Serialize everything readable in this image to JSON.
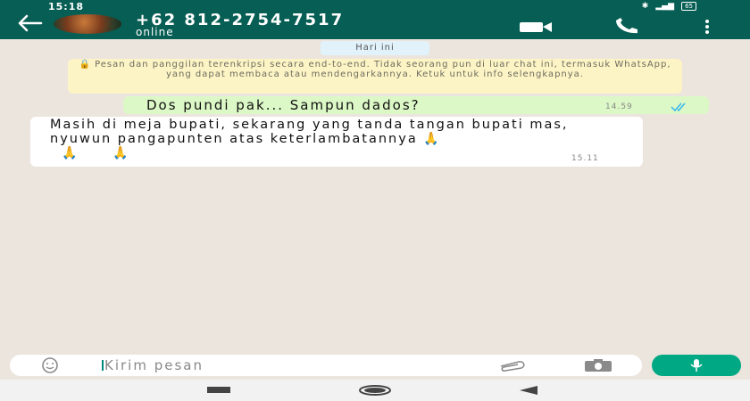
{
  "status_bar": {
    "time": "15:18",
    "battery": "65"
  },
  "header": {
    "contact_name": "+62 812-2754-7517",
    "contact_status": "online"
  },
  "chat": {
    "date_chip": "Hari ini",
    "encryption_notice": "🔒 Pesan dan panggilan terenkripsi secara end-to-end. Tidak seorang pun di luar chat ini, termasuk WhatsApp, yang dapat membaca atau mendengarkannya. Ketuk untuk info selengkapnya.",
    "messages": [
      {
        "direction": "outgoing",
        "text": "Dos pundi pak... Sampun dados?",
        "time": "14.59",
        "status": "read"
      },
      {
        "direction": "incoming",
        "text": "Masih di meja bupati, sekarang yang tanda tangan bupati mas, nyuwun pangapunten atas keterlambatannya",
        "emoji_1": "🙏",
        "emoji_2": "🙏",
        "emoji_3": "🙏",
        "time": "15.11"
      }
    ]
  },
  "input": {
    "placeholder": "Kirim pesan"
  },
  "icons": [
    "back-arrow-icon",
    "video-call-icon",
    "phone-icon",
    "more-vert-icon",
    "emoji-icon",
    "attach-icon",
    "camera-icon",
    "mic-icon",
    "read-ticks-icon"
  ],
  "colors": {
    "header": "#075e54",
    "accent": "#00a884",
    "outgoing_bubble": "#dcf8c6",
    "incoming_bubble": "#ffffff",
    "encryption_bg": "#fdf4c5",
    "read_ticks": "#34b7f1"
  }
}
